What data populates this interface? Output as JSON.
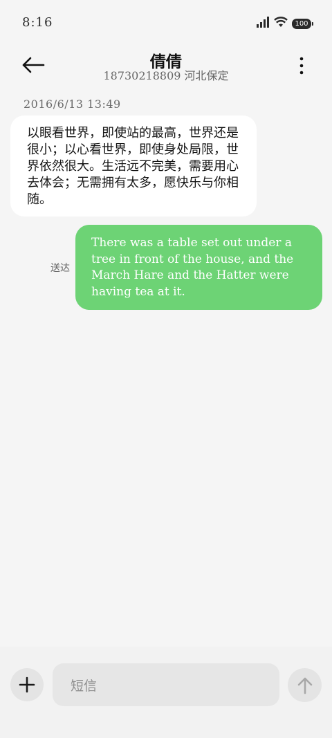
{
  "status_bar": {
    "time": "8:16",
    "battery": "100",
    "icons": [
      "signal-icon",
      "wifi-icon",
      "battery-icon"
    ]
  },
  "header": {
    "contact_name": "倩倩",
    "contact_number_location": "18730218809 河北保定",
    "icons": [
      "back-arrow-icon",
      "more-vertical-icon"
    ]
  },
  "conversation": {
    "timestamp": "2016/6/13 13:49",
    "received_message": "以眼看世界，即使站的最高，世界还是很小；以心看世界，即使身处局限，世界依然很大。生活远不完美，需要用心去体会；无需拥有太多，愿快乐与你相随。",
    "sent_message": "There was a table set out under a tree in front of the house, and the March Hare and the Hatter were having tea at it.",
    "sent_status": "送达"
  },
  "composer": {
    "placeholder": "短信",
    "icons": [
      "plus-icon",
      "send-arrow-icon"
    ]
  },
  "colors": {
    "background": "#f5f5f5",
    "sent_bubble": "#6dd375",
    "received_bubble": "#ffffff"
  }
}
